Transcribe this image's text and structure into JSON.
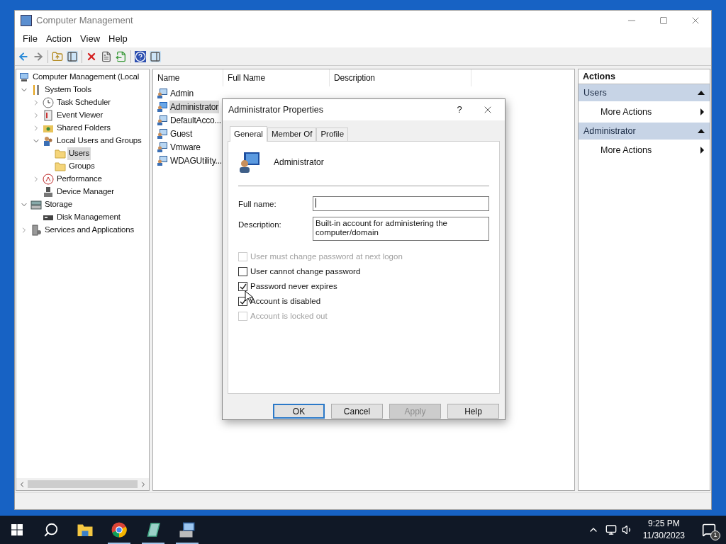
{
  "window": {
    "title": "Computer Management"
  },
  "menu": [
    "File",
    "Action",
    "View",
    "Help"
  ],
  "tree": [
    {
      "label": "Computer Management (Local",
      "selected": false,
      "children": [
        {
          "label": "System Tools",
          "expanded": true,
          "selected": false,
          "children": [
            {
              "label": "Task Scheduler",
              "expanded": false,
              "selected": false
            },
            {
              "label": "Event Viewer",
              "expanded": false,
              "selected": false
            },
            {
              "label": "Shared Folders",
              "expanded": false,
              "selected": false
            },
            {
              "label": "Local Users and Groups",
              "expanded": true,
              "selected": false,
              "children": [
                {
                  "label": "Users",
                  "selected": true
                },
                {
                  "label": "Groups",
                  "selected": false
                }
              ]
            },
            {
              "label": "Performance",
              "expanded": false,
              "selected": false
            },
            {
              "label": "Device Manager",
              "selected": false
            }
          ]
        },
        {
          "label": "Storage",
          "expanded": true,
          "selected": false,
          "children": [
            {
              "label": "Disk Management",
              "selected": false
            }
          ]
        },
        {
          "label": "Services and Applications",
          "expanded": false,
          "selected": false
        }
      ]
    }
  ],
  "list": {
    "columns": [
      "Name",
      "Full Name",
      "Description"
    ],
    "rows": [
      {
        "name": "Admin",
        "selected": false
      },
      {
        "name": "Administrator",
        "selected": true
      },
      {
        "name": "DefaultAcco...",
        "selected": false
      },
      {
        "name": "Guest",
        "selected": false
      },
      {
        "name": "Vmware",
        "selected": false
      },
      {
        "name": "WDAGUtility...",
        "selected": false
      }
    ]
  },
  "actions": {
    "title": "Actions",
    "sections": [
      {
        "title": "Users",
        "items": [
          "More Actions"
        ]
      },
      {
        "title": "Administrator",
        "items": [
          "More Actions"
        ]
      }
    ]
  },
  "dialog": {
    "title": "Administrator Properties",
    "help_glyph": "?",
    "tabs": [
      {
        "label": "General",
        "selected": true
      },
      {
        "label": "Member Of",
        "selected": false
      },
      {
        "label": "Profile",
        "selected": false
      }
    ],
    "user_name": "Administrator",
    "fields": [
      {
        "label": "Full name:"
      },
      {
        "label": "Description:",
        "value": "Built-in account for administering the computer/domain"
      }
    ],
    "checkboxes": [
      {
        "label": "User must change password at next logon",
        "checked": false,
        "disabled": true
      },
      {
        "label": "User cannot change password",
        "checked": false,
        "disabled": false
      },
      {
        "label": "Password never expires",
        "checked": true,
        "disabled": false
      },
      {
        "label": "Account is disabled",
        "checked": true,
        "disabled": false
      },
      {
        "label": "Account is locked out",
        "checked": false,
        "disabled": true
      }
    ],
    "buttons": [
      {
        "label": "OK",
        "default": true,
        "disabled": false
      },
      {
        "label": "Cancel",
        "default": false,
        "disabled": false
      },
      {
        "label": "Apply",
        "default": false,
        "disabled": true
      },
      {
        "label": "Help",
        "default": false,
        "disabled": false
      }
    ]
  },
  "taskbar": {
    "apps": [
      {
        "kind": "explorer",
        "running": false
      },
      {
        "kind": "chrome",
        "running": true
      },
      {
        "kind": "notes",
        "running": true
      },
      {
        "kind": "manager",
        "running": true
      }
    ],
    "time": "9:25 PM",
    "date": "11/30/2023",
    "notification_count": "1"
  }
}
